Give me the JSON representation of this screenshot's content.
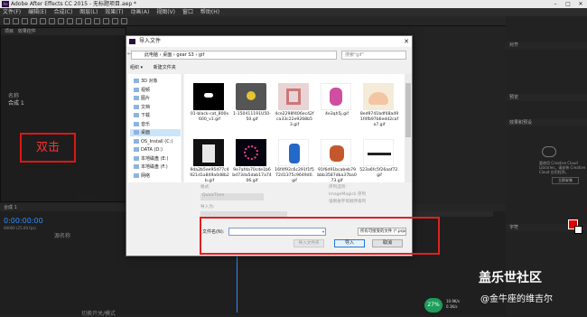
{
  "app": {
    "title": "Adobe After Effects CC 2015 - 无标题项目.aep *",
    "logo_text": "Ae"
  },
  "menu": [
    "文件(F)",
    "编辑(E)",
    "合成(C)",
    "图层(L)",
    "效果(T)",
    "动画(A)",
    "视图(V)",
    "窗口",
    "帮助(H)"
  ],
  "panels": {
    "project": "项目",
    "effects_controls": "效果控件",
    "align": "对齐",
    "effects_presets": "效果和预设",
    "preview": "预览",
    "character": "字符",
    "timeline_tab": "合成 1"
  },
  "left_panel": {
    "row_name": "名称",
    "row1": "合成 1",
    "annotation": "双击"
  },
  "timeline": {
    "timecode": "0:00:00:00",
    "fps": "00000 (25.00 fps)",
    "col_name": "源名称",
    "toggle": "切换开关/模式"
  },
  "right": {
    "cc_text": "要使用 Creative Cloud Libraries，请安装 Creative Cloud 应用程序。",
    "cc_button": "立即安装",
    "color_hex": "#e10000"
  },
  "watermark": {
    "line1": "盖乐世社区",
    "line2": "@金牛座的维吉尔"
  },
  "status": {
    "cpu_pct": "27%",
    "net_up": "10.9K/s",
    "net_down": "0.1K/s"
  },
  "dialog": {
    "title": "导入文件",
    "breadcrumb": [
      "此电脑",
      "桌面",
      "gear S3",
      "gif"
    ],
    "search_placeholder": "搜索\"gif\"",
    "organize": "组织 ▾",
    "new_folder": "新建文件夹",
    "tree": [
      {
        "label": "3D 对象"
      },
      {
        "label": "视频"
      },
      {
        "label": "图片"
      },
      {
        "label": "文档"
      },
      {
        "label": "下载"
      },
      {
        "label": "音乐"
      },
      {
        "label": "桌面",
        "selected": true
      },
      {
        "label": "OS_Install (C:)"
      },
      {
        "label": "DATA (D:)"
      },
      {
        "label": "本地磁盘 (E:)"
      },
      {
        "label": "本地磁盘 (F:)"
      },
      {
        "label": "网络"
      }
    ],
    "files": [
      {
        "name": "01-black-cat_800x600_v1.gif",
        "icon": "black-cat-thumb"
      },
      {
        "name": "1-150411191U50-50.gif",
        "icon": "gray-face-thumb"
      },
      {
        "name": "4ce2298f406ec42fca33c22e9268b53.gif",
        "icon": "pink-shape-thumb"
      },
      {
        "name": "4e3qh5j.gif",
        "icon": "bird-thumb"
      },
      {
        "name": "8ed9741bdf48a491f4fb97b6edd2cafa7.gif",
        "icon": "face-thumb"
      },
      {
        "name": "9da2b5ee95d77c4921d1a849a0d8b2b.gif",
        "icon": "poster-thumb"
      },
      {
        "name": "9e7afda70cde1b6bd73da5dab17a7406.gif",
        "icon": "dots-thumb"
      },
      {
        "name": "16f4f92c6c291f1f572d1375c9649d0.gif",
        "icon": "figure-thumb"
      },
      {
        "name": "91f6d91bcabeb79bbb3587dba37ba073.gif",
        "icon": "rooster-thumb"
      },
      {
        "name": "523a6fc5f26aaf72.gif",
        "icon": "table-thumb"
      }
    ],
    "details": {
      "format": "格式:",
      "format_val": "QuickTime",
      "import_as": "导入为:",
      "seq": "序列选项:",
      "seq1": "ImageMagick 序列",
      "seq2": "强制按字母顺序排列"
    },
    "filename_label": "文件名(N):",
    "filename_value": "",
    "filetype": "所有可接受的文件 (*.prproj;*.c",
    "btn_seq": "导入文件夹",
    "btn_import": "导入",
    "btn_cancel": "取消"
  }
}
